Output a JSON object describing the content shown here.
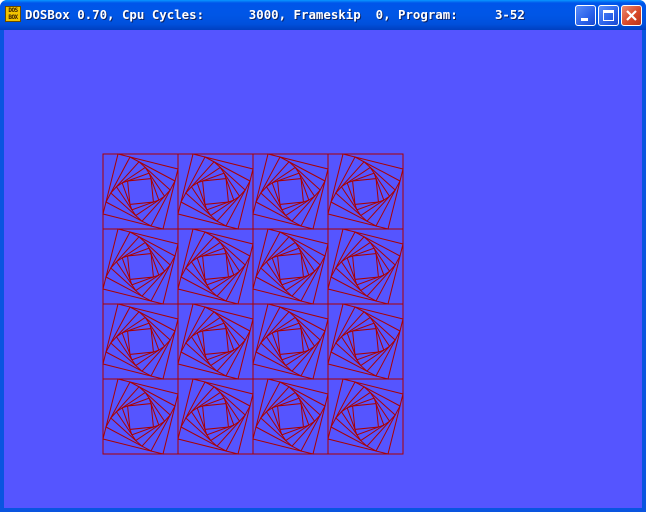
{
  "window": {
    "title": "DOSBox 0.70, Cpu Cycles:      3000, Frameskip  0, Program:     3-52",
    "app_icon_text_line1": "DOS",
    "app_icon_text_line2": "BOX"
  },
  "controls": {
    "minimize_icon": "minimize-icon",
    "maximize_icon": "maximize-icon",
    "close_icon": "close-icon"
  },
  "screen": {
    "background_color": "#5555ff",
    "line_color": "#aa0000",
    "grid_rows": 4,
    "grid_cols": 4,
    "nested_squares_per_cell": 7
  }
}
